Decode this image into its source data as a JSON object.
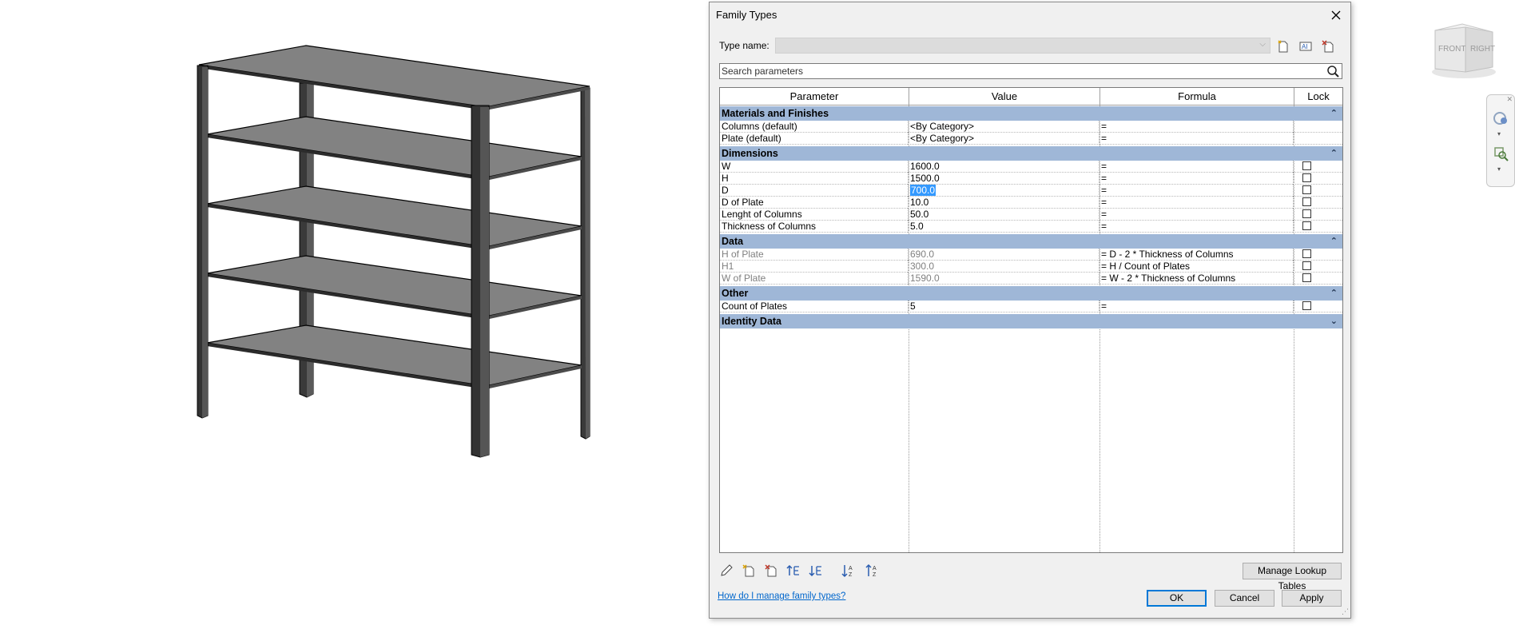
{
  "dialog": {
    "title": "Family Types",
    "type_name_label": "Type name:",
    "type_name_value": "",
    "search_placeholder": "Search parameters"
  },
  "grid": {
    "headers": [
      "Parameter",
      "Value",
      "Formula",
      "Lock"
    ],
    "groups": [
      {
        "name": "Materials and Finishes",
        "collapse_icon": "chevron-up-double-icon",
        "rows": [
          {
            "parameter": "Columns (default)",
            "value": "<By Category>",
            "formula": "=",
            "lock": null,
            "readonly": false
          },
          {
            "parameter": "Plate (default)",
            "value": "<By Category>",
            "formula": "=",
            "lock": null,
            "readonly": false
          }
        ]
      },
      {
        "name": "Dimensions",
        "collapse_icon": "chevron-up-double-icon",
        "rows": [
          {
            "parameter": "W",
            "value": "1600.0",
            "formula": "=",
            "lock": false,
            "readonly": false
          },
          {
            "parameter": "H",
            "value": "1500.0",
            "formula": "=",
            "lock": false,
            "readonly": false
          },
          {
            "parameter": "D",
            "value": "700.0",
            "formula": "=",
            "lock": false,
            "readonly": false,
            "selected": true
          },
          {
            "parameter": "D of Plate",
            "value": "10.0",
            "formula": "=",
            "lock": false,
            "readonly": false
          },
          {
            "parameter": "Lenght of Columns",
            "value": "50.0",
            "formula": "=",
            "lock": false,
            "readonly": false
          },
          {
            "parameter": "Thickness of Columns",
            "value": "5.0",
            "formula": "=",
            "lock": false,
            "readonly": false
          }
        ]
      },
      {
        "name": "Data",
        "collapse_icon": "chevron-up-double-icon",
        "rows": [
          {
            "parameter": "H of Plate",
            "value": "690.0",
            "formula": "= D - 2 * Thickness of Columns",
            "lock": false,
            "readonly": true
          },
          {
            "parameter": "H1",
            "value": "300.0",
            "formula": "= H / Count of Plates",
            "lock": false,
            "readonly": true
          },
          {
            "parameter": "W of Plate",
            "value": "1590.0",
            "formula": "= W - 2 * Thickness of Columns",
            "lock": false,
            "readonly": true
          }
        ]
      },
      {
        "name": "Other",
        "collapse_icon": "chevron-up-double-icon",
        "rows": [
          {
            "parameter": "Count of Plates",
            "value": "5",
            "formula": "=",
            "lock": false,
            "readonly": false
          }
        ]
      },
      {
        "name": "Identity Data",
        "collapse_icon": "chevron-down-double-icon",
        "rows": []
      }
    ]
  },
  "toolbar": {
    "manage_lookup_label": "Manage Lookup Tables",
    "help_link": "How do I manage family types?",
    "ok_label": "OK",
    "cancel_label": "Cancel",
    "apply_label": "Apply"
  },
  "viewcube": {
    "front_label": "FRONT",
    "right_label": "RIGHT"
  },
  "colors": {
    "group_header": "#9fb7d7",
    "selection": "#3399ff",
    "shelf_gray": "#808080",
    "column_dark": "#3c3c3c"
  }
}
